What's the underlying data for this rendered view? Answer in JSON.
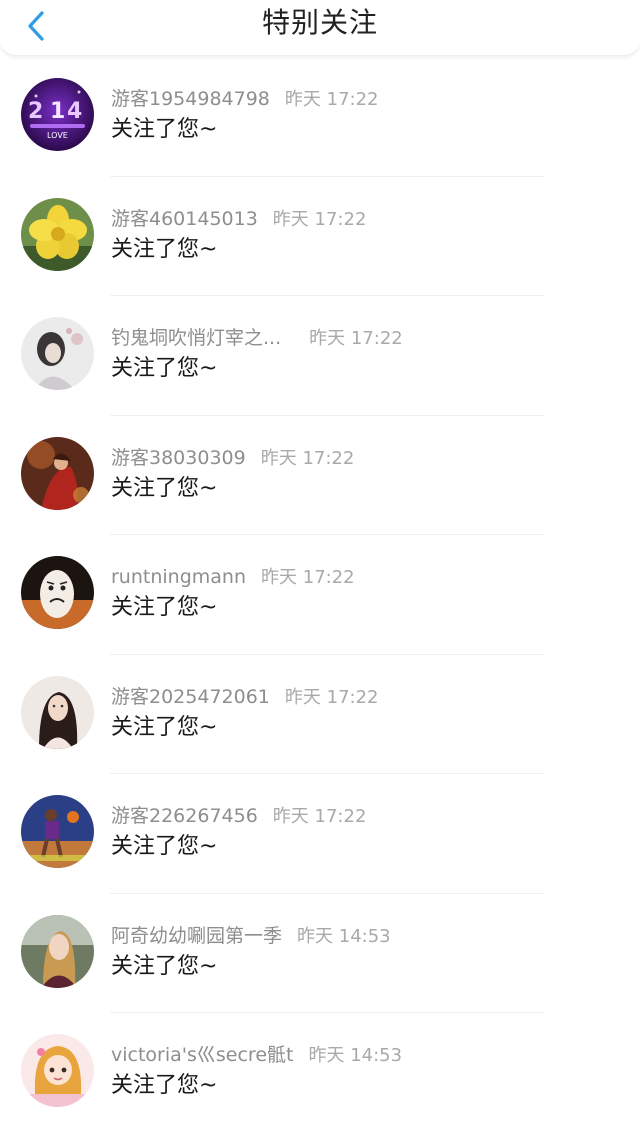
{
  "header": {
    "title": "特别关注",
    "back_icon": "chevron-left-icon",
    "accent_color": "#2e9ce6"
  },
  "items": [
    {
      "name": "游客1954984798",
      "time": "昨天 17:22",
      "message": "关注了您~",
      "avatar": "avatar-purple-214-love"
    },
    {
      "name": "游客460145013",
      "time": "昨天 17:22",
      "message": "关注了您~",
      "avatar": "avatar-yellow-flower"
    },
    {
      "name": "钓鬼垌吹悄灯宰之...",
      "time": "昨天 17:22",
      "message": "关注了您~",
      "avatar": "avatar-ink-painting"
    },
    {
      "name": "游客38030309",
      "time": "昨天 17:22",
      "message": "关注了您~",
      "avatar": "avatar-red-warrior"
    },
    {
      "name": "runtningmann",
      "time": "昨天 17:22",
      "message": "关注了您~",
      "avatar": "avatar-egg-face"
    },
    {
      "name": "游客2025472061",
      "time": "昨天 17:22",
      "message": "关注了您~",
      "avatar": "avatar-girl-dark-hair"
    },
    {
      "name": "游客226267456",
      "time": "昨天 17:22",
      "message": "关注了您~",
      "avatar": "avatar-basketball-player"
    },
    {
      "name": "阿奇幼幼唰园第一季",
      "time": "昨天 14:53",
      "message": "关注了您~",
      "avatar": "avatar-blonde-woman"
    },
    {
      "name": "victoria's巛secre骶t",
      "time": "昨天 14:53",
      "message": "关注了您~",
      "avatar": "avatar-cartoon-girl"
    }
  ]
}
